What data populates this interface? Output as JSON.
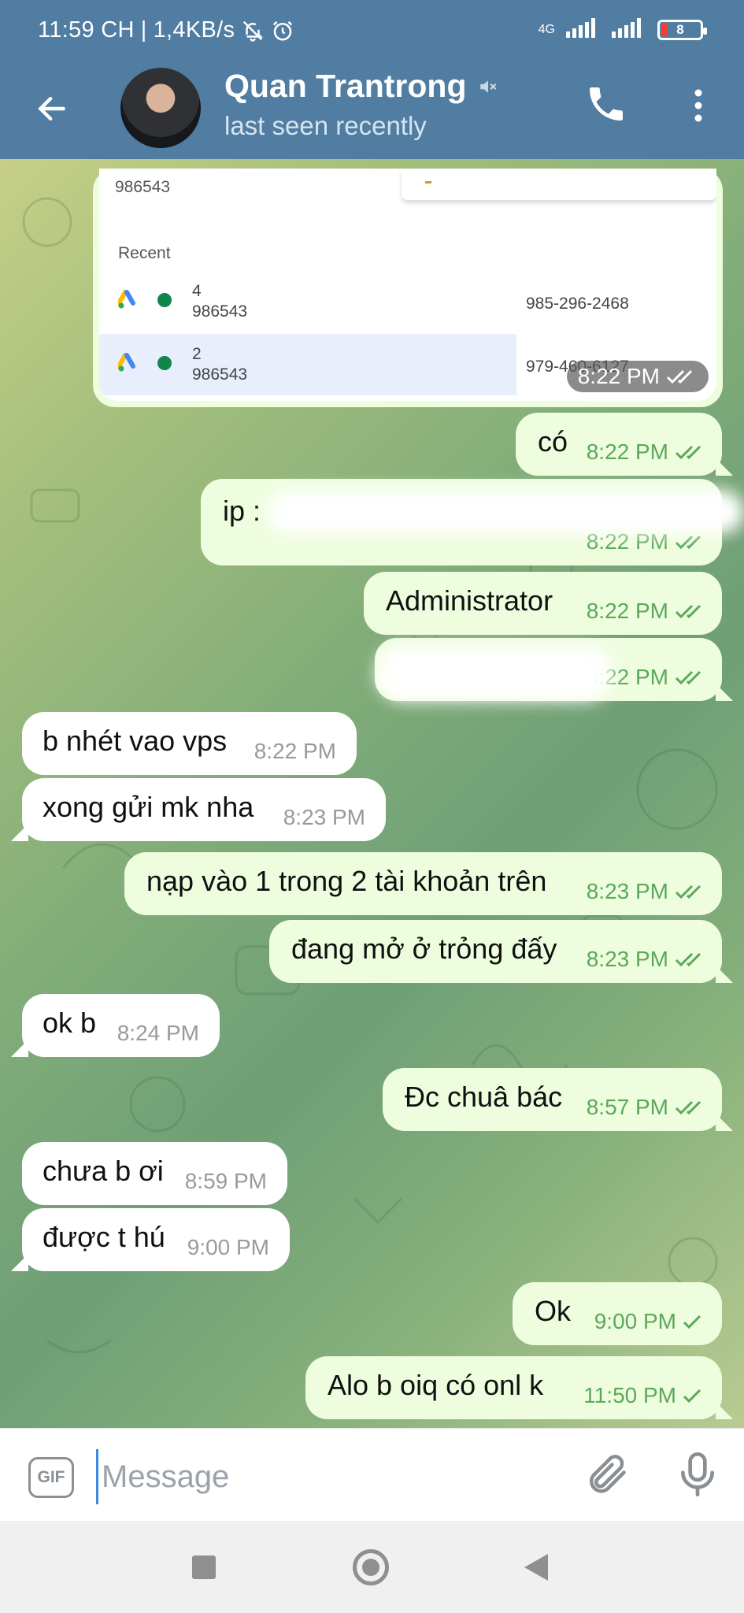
{
  "status": {
    "time": "11:59 CH",
    "speed": "1,4KB/s",
    "network": "4G",
    "battery": "8"
  },
  "header": {
    "name": "Quan Trantrong",
    "last_seen": "last seen recently"
  },
  "image_message": {
    "top_number": "986543",
    "recent_label": "Recent",
    "rows": [
      {
        "n1": "4",
        "n2": "986543",
        "phone": "985-296-2468"
      },
      {
        "n1": "2",
        "n2": "986543",
        "phone": "979-460-6127"
      }
    ],
    "time": "8:22 PM"
  },
  "messages": [
    {
      "dir": "out",
      "text": "có",
      "time": "8:22 PM"
    },
    {
      "dir": "out",
      "text": "ip :",
      "time": "8:22 PM"
    },
    {
      "dir": "out",
      "text": "Administrator",
      "time": "8:22 PM"
    },
    {
      "dir": "out",
      "text": "",
      "time": "8:22 PM"
    },
    {
      "dir": "in",
      "text": "b nhét vao vps",
      "time": "8:22 PM"
    },
    {
      "dir": "in",
      "text": "xong gửi mk nha",
      "time": "8:23 PM"
    },
    {
      "dir": "out",
      "text": "nạp vào 1 trong 2 tài khoản trên",
      "time": "8:23 PM"
    },
    {
      "dir": "out",
      "text": "đang mở ở trỏng đấy",
      "time": "8:23 PM"
    },
    {
      "dir": "in",
      "text": "ok b",
      "time": "8:24 PM"
    },
    {
      "dir": "out",
      "text": "Đc chuâ bác",
      "time": "8:57 PM"
    },
    {
      "dir": "in",
      "text": "chưa b ơi",
      "time": "8:59 PM"
    },
    {
      "dir": "in",
      "text": "được t hú",
      "time": "9:00 PM"
    },
    {
      "dir": "out",
      "text": "Ok",
      "time": "9:00 PM"
    },
    {
      "dir": "out",
      "text": "Alo b oiq có onl k",
      "time": "11:50 PM"
    }
  ],
  "input": {
    "gif_label": "GIF",
    "placeholder": "Message"
  },
  "icons": {
    "back": "arrow-left-icon",
    "mute": "muted-speaker-icon",
    "call": "phone-icon",
    "more": "more-vertical-icon",
    "attach": "paperclip-icon",
    "mic": "microphone-icon"
  },
  "colors": {
    "header": "#517da2",
    "outgoing_bubble": "#effddf",
    "incoming_bubble": "#ffffff",
    "check_color": "#5aa85a"
  }
}
